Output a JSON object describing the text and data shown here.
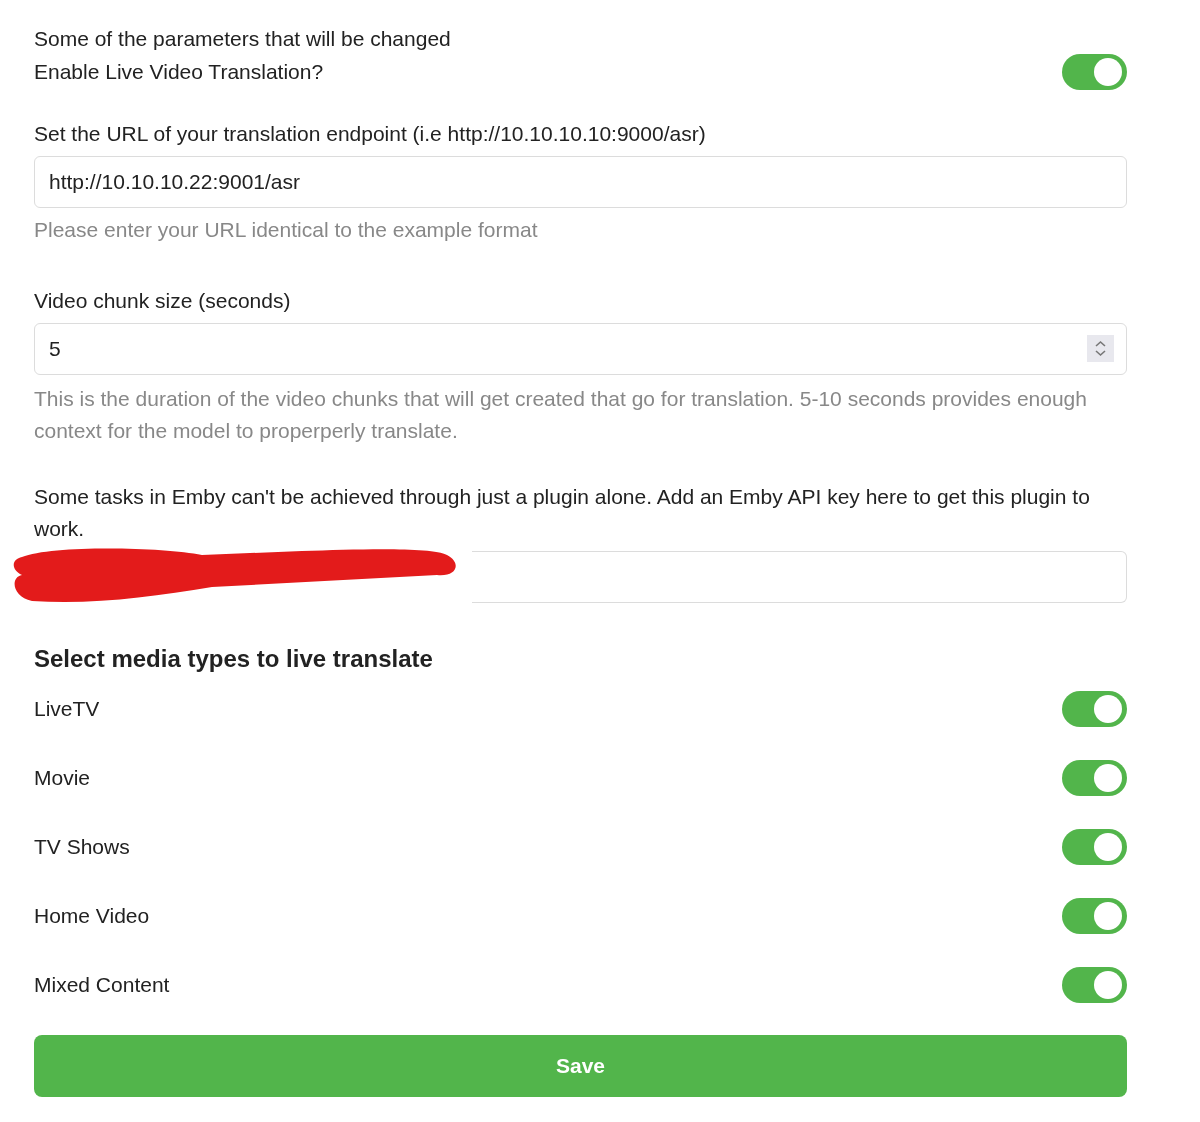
{
  "intro": "Some of the parameters that will be changed",
  "enable": {
    "label": "Enable Live Video Translation?",
    "on": true
  },
  "endpoint": {
    "label": "Set the URL of your translation endpoint (i.e http://10.10.10.10:9000/asr)",
    "value": "http://10.10.10.22:9001/asr",
    "help": "Please enter your URL identical to the example format"
  },
  "chunk": {
    "label": "Video chunk size (seconds)",
    "value": "5",
    "help": "This is the duration of the video chunks that will get created that go for translation. 5-10 seconds provides enough context for the model to properperly translate."
  },
  "api_key": {
    "label": "Some tasks in Emby can't be achieved through just a plugin alone. Add an Emby API key here to get this plugin to work."
  },
  "media_heading": "Select media types to live translate",
  "media_types": [
    {
      "label": "LiveTV",
      "on": true
    },
    {
      "label": "Movie",
      "on": true
    },
    {
      "label": "TV Shows",
      "on": true
    },
    {
      "label": "Home Video",
      "on": true
    },
    {
      "label": "Mixed Content",
      "on": true
    }
  ],
  "save_button": "Save"
}
